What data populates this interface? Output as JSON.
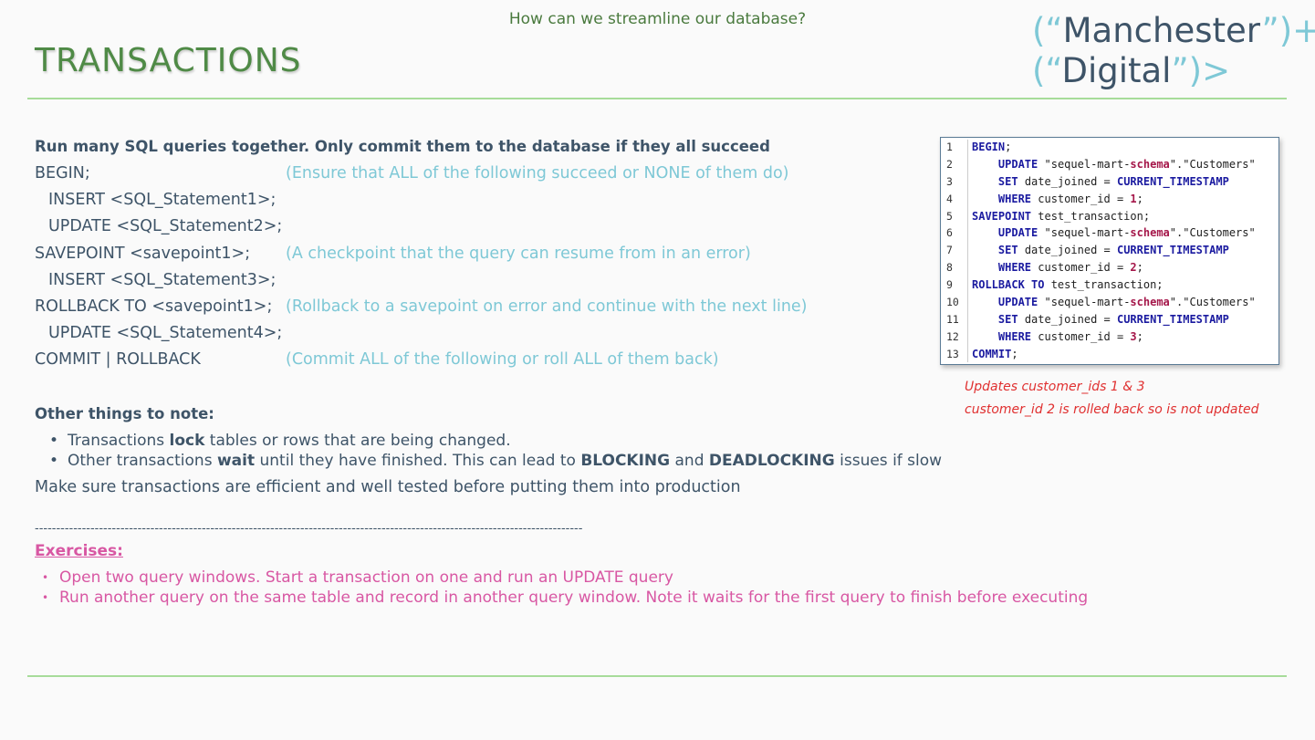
{
  "header": {
    "subtitle": "How can we streamline our database?",
    "title": "TRANSACTIONS",
    "logo_line1_open": "(“",
    "logo_line1_word": "Manchester",
    "logo_line1_close": "”)+",
    "logo_line2_open": "(“",
    "logo_line2_word": "Digital",
    "logo_line2_close": "”)>"
  },
  "intro": {
    "heading": "Run many SQL queries together.  Only commit them to the database if they all succeed",
    "steps": [
      {
        "code": "BEGIN;",
        "note": "(Ensure that ALL of the following succeed or NONE of them do)"
      },
      {
        "code": "INSERT <SQL_Statement1>;",
        "note": ""
      },
      {
        "code": "UPDATE <SQL_Statement2>;",
        "note": ""
      },
      {
        "code": "SAVEPOINT <savepoint1>;",
        "note": "(A checkpoint that the query can resume from in an error)"
      },
      {
        "code": "INSERT <SQL_Statement3>;",
        "note": ""
      },
      {
        "code": "ROLLBACK TO <savepoint1>;",
        "note": "(Rollback to a savepoint on error and continue with the next line)"
      },
      {
        "code": "UPDATE <SQL_Statement4>;",
        "note": ""
      },
      {
        "code": "COMMIT | ROLLBACK",
        "note": "(Commit ALL of the following or roll ALL of them back)"
      }
    ]
  },
  "notes": {
    "heading": "Other things to note:",
    "bullet1_pre": "Transactions ",
    "bullet1_bold": "lock",
    "bullet1_post": " tables or rows that are being changed.",
    "bullet2_pre": "Other transactions ",
    "bullet2_bold1": "wait",
    "bullet2_mid": " until they have finished.  This can lead to ",
    "bullet2_bold2": "BLOCKING",
    "bullet2_and": " and ",
    "bullet2_bold3": "DEADLOCKING",
    "bullet2_post": " issues if slow",
    "summary": "Make sure transactions are efficient and well tested before putting them into production"
  },
  "divider": "--------------------------------------------------------------------------------------------------------------------------------",
  "exercises": {
    "title": "Exercises:",
    "items": [
      "Open two query windows.  Start a transaction on one and run an UPDATE query",
      "Run another query on the same table and record in another query window.  Note it waits for the first query to finish before executing"
    ]
  },
  "code_example": {
    "lines": [
      {
        "n": "1",
        "text": "BEGIN;"
      },
      {
        "n": "2",
        "text": "    UPDATE \"sequel-mart-schema\".\"Customers\""
      },
      {
        "n": "3",
        "text": "    SET date_joined = CURRENT_TIMESTAMP"
      },
      {
        "n": "4",
        "text": "    WHERE customer_id = 1;"
      },
      {
        "n": "5",
        "text": "SAVEPOINT test_transaction;"
      },
      {
        "n": "6",
        "text": "    UPDATE \"sequel-mart-schema\".\"Customers\""
      },
      {
        "n": "7",
        "text": "    SET date_joined = CURRENT_TIMESTAMP"
      },
      {
        "n": "8",
        "text": "    WHERE customer_id = 2;"
      },
      {
        "n": "9",
        "text": "ROLLBACK TO test_transaction;"
      },
      {
        "n": "10",
        "text": "    UPDATE \"sequel-mart-schema\".\"Customers\""
      },
      {
        "n": "11",
        "text": "    SET date_joined = CURRENT_TIMESTAMP"
      },
      {
        "n": "12",
        "text": "    WHERE customer_id = 3;"
      },
      {
        "n": "13",
        "text": "COMMIT;"
      }
    ],
    "caption1": "Updates customer_ids 1 & 3",
    "caption2": "customer_id 2 is rolled back so is not updated"
  },
  "colors": {
    "title": "#4f8a46",
    "accent": "#7ec8d6",
    "rule": "#a7dc9a",
    "exercise": "#d857a3",
    "caption": "#e03030"
  }
}
